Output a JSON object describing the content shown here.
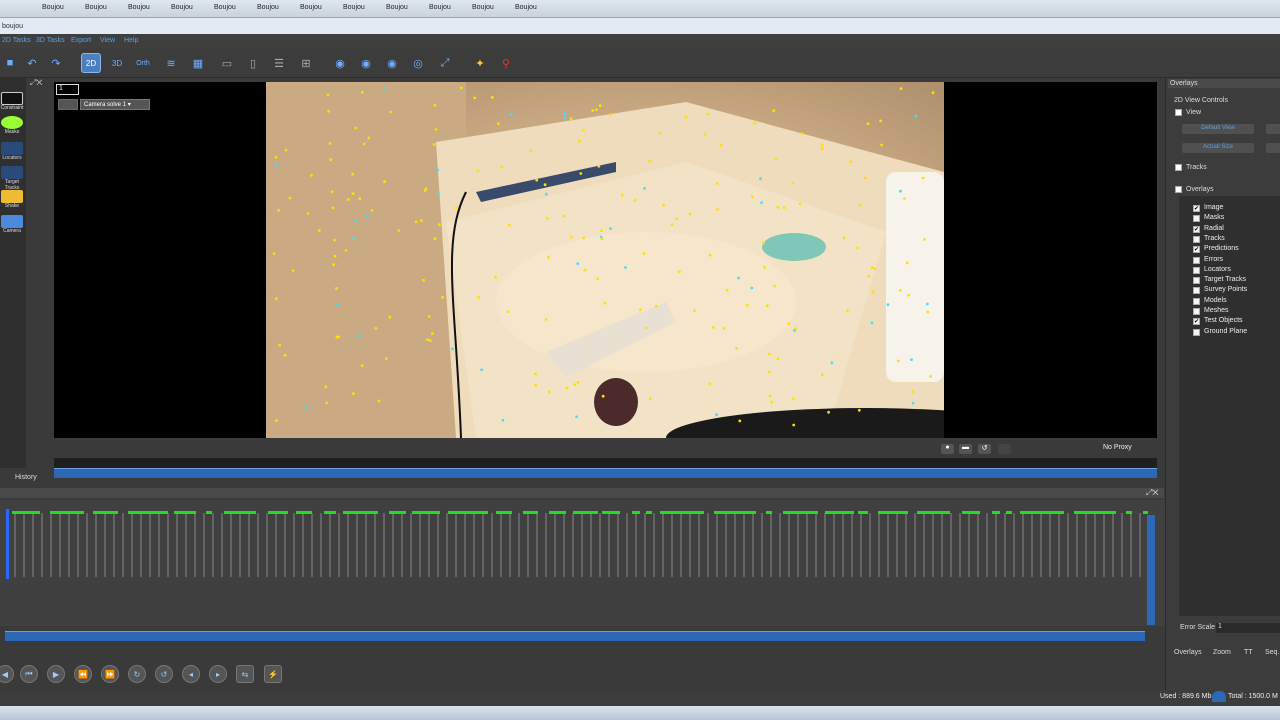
{
  "taskbar": {
    "items": [
      "Boujou",
      "Boujou",
      "Boujou",
      "Boujou",
      "Boujou",
      "Boujou",
      "Boujou",
      "Boujou",
      "Boujou",
      "Boujou",
      "Boujou",
      "Boujou",
      "Boujou"
    ]
  },
  "window": {
    "title": "boujou"
  },
  "menu": {
    "items": [
      "2D Tasks",
      "3D Tasks",
      "Export",
      "View",
      "Help"
    ]
  },
  "toolbar": {
    "tools": [
      "save-icon",
      "undo-icon",
      "redo-icon",
      "2d-view-icon",
      "3d-view-icon",
      "orth-view-icon",
      "graph-icon",
      "grid-icon",
      "layout-a-icon",
      "layout-b-icon",
      "layout-c-icon",
      "layout-d-icon",
      "globe-a-icon",
      "globe-b-icon",
      "globe-c-icon",
      "globe-d-icon",
      "fit-icon",
      "magic-icon",
      "zoom-icon"
    ],
    "labels": {
      "view2d": "2D",
      "view3d": "3D",
      "orth": "Orth"
    }
  },
  "left_tools": [
    "Constraint",
    "Masks",
    "Locators",
    "Target Tracks",
    "Shake",
    "Camera"
  ],
  "viewport": {
    "frame": "1",
    "camera": "Camera solve 1",
    "proxy": "No Proxy"
  },
  "history": {
    "label": "History"
  },
  "right_panel": {
    "header": "Overlays",
    "section": "2D View Controls",
    "view_label": "View",
    "default_view": "Default View",
    "actual_size": "Actual Size",
    "tracks_label": "Tracks",
    "overlays_label": "Overlays",
    "overlay_items": [
      {
        "label": "Image",
        "checked": true
      },
      {
        "label": "Masks",
        "checked": false
      },
      {
        "label": "Radial",
        "checked": true
      },
      {
        "label": "Tracks",
        "checked": false
      },
      {
        "label": "Predictions",
        "checked": true
      },
      {
        "label": "Errors",
        "checked": false
      },
      {
        "label": "Locators",
        "checked": false
      },
      {
        "label": "Target Tracks",
        "checked": false
      },
      {
        "label": "Survey Points",
        "checked": false
      },
      {
        "label": "Models",
        "checked": false
      },
      {
        "label": "Meshes",
        "checked": false
      },
      {
        "label": "Test Objects",
        "checked": true
      },
      {
        "label": "Ground Plane",
        "checked": false
      }
    ],
    "error_scale_label": "Error Scale",
    "error_scale_value": "1",
    "tabs": [
      "Overlays",
      "Zoom",
      "TT",
      "Seq."
    ]
  },
  "status": {
    "used": "Used : 889.6 Mb",
    "total": "Total : 1500.0 M"
  },
  "colors": {
    "accent": "#2b68b5",
    "track_green": "#22dd22",
    "marker_yellow": "#ffe000",
    "marker_cyan": "#40e0ff"
  }
}
